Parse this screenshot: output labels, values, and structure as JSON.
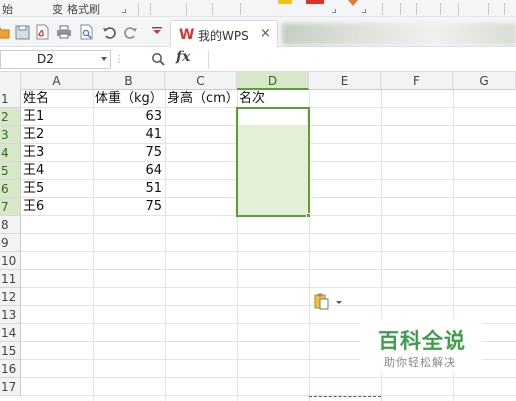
{
  "ribbon": {
    "fragment_1": "始",
    "fragment_2": "变",
    "fragment_3": "格式刷",
    "icons": [
      "dialog-launcher-icon",
      "yellow-highlight-icon",
      "red-font-icon",
      "orange-arrow-icon"
    ]
  },
  "quick_access": {
    "icons": [
      "open-folder-icon",
      "save-icon",
      "export-pdf-icon",
      "print-icon",
      "print-preview-icon",
      "undo-icon",
      "redo-icon",
      "customize-icon"
    ]
  },
  "tabs": {
    "active_label": "我的WPS",
    "close_glyph": "×",
    "logo_glyph": "W"
  },
  "formula_bar": {
    "name_box": "D2",
    "fx_label": "fx",
    "formula": ""
  },
  "grid": {
    "columns": [
      "A",
      "B",
      "C",
      "D",
      "E",
      "F",
      "G"
    ],
    "selected_column": "D",
    "rows": [
      "1",
      "2",
      "3",
      "4",
      "5",
      "6",
      "7",
      "8",
      "9",
      "10",
      "11",
      "12",
      "13",
      "14",
      "15",
      "16",
      "17"
    ],
    "selected_rows": [
      "2",
      "3",
      "4",
      "5",
      "6",
      "7"
    ],
    "header_row": [
      "姓名",
      "体重（kg）",
      "身高（cm）",
      "名次"
    ],
    "data": [
      {
        "name": "王1",
        "weight": "63"
      },
      {
        "name": "王2",
        "weight": "41"
      },
      {
        "name": "王3",
        "weight": "75"
      },
      {
        "name": "王4",
        "weight": "64"
      },
      {
        "name": "王5",
        "weight": "51"
      },
      {
        "name": "王6",
        "weight": "75"
      }
    ],
    "selected_range": "D2:D7"
  },
  "watermark": {
    "title": "百科全说",
    "subtitle": "助你轻松解决"
  },
  "colors": {
    "selection_border": "#5a9e3a",
    "selection_fill": "#e2f0d7",
    "wps_red": "#e0322d",
    "watermark_green": "#3e9e4a"
  }
}
